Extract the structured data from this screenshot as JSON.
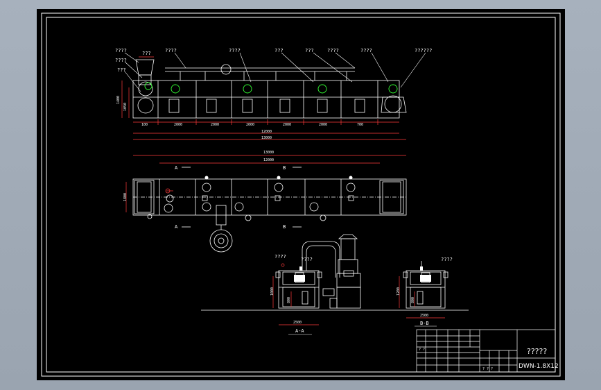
{
  "colors": {
    "background": "#a3adb9",
    "sheet": "#000000",
    "line": "#ffffff",
    "dimension": "#ff3b3b",
    "equipment": "#33ff33"
  },
  "top_view_labels": {
    "feed_hopper": "????",
    "hopper": "????",
    "inlet": "???",
    "width": "???",
    "frame": "????",
    "fan_a": "????",
    "duct": "???",
    "fan_b": "???",
    "fan_c": "????",
    "fan_d": "????",
    "outlet": "??????"
  },
  "top_view_dims": {
    "hopper_width": "???",
    "height_a": "1400",
    "height_b": "1050",
    "seg_1": "100",
    "seg_2": "2000",
    "seg_3": "2000",
    "seg_4": "2000",
    "seg_5": "2000",
    "seg_6": "2000",
    "seg_7": "700",
    "total_inner": "12000",
    "total_outer": "13000"
  },
  "plan_view": {
    "total_outer": "13000",
    "total_inner": "12000",
    "section_a": "A",
    "section_b": "B",
    "width": "1800"
  },
  "section_aa": {
    "label_left": "????",
    "label_right": "????",
    "height": "1000",
    "mid_height": "800",
    "width": "2500",
    "caption": "A-A"
  },
  "section_bb": {
    "label": "????",
    "height": "1200",
    "mid_height": "800",
    "width": "2500",
    "caption": "B-B"
  },
  "title_block": {
    "drawing_name": "?????",
    "model_code": "DWN-1.8X12",
    "scale_hint": "? ?",
    "sheet_hint": "? ? ?"
  }
}
